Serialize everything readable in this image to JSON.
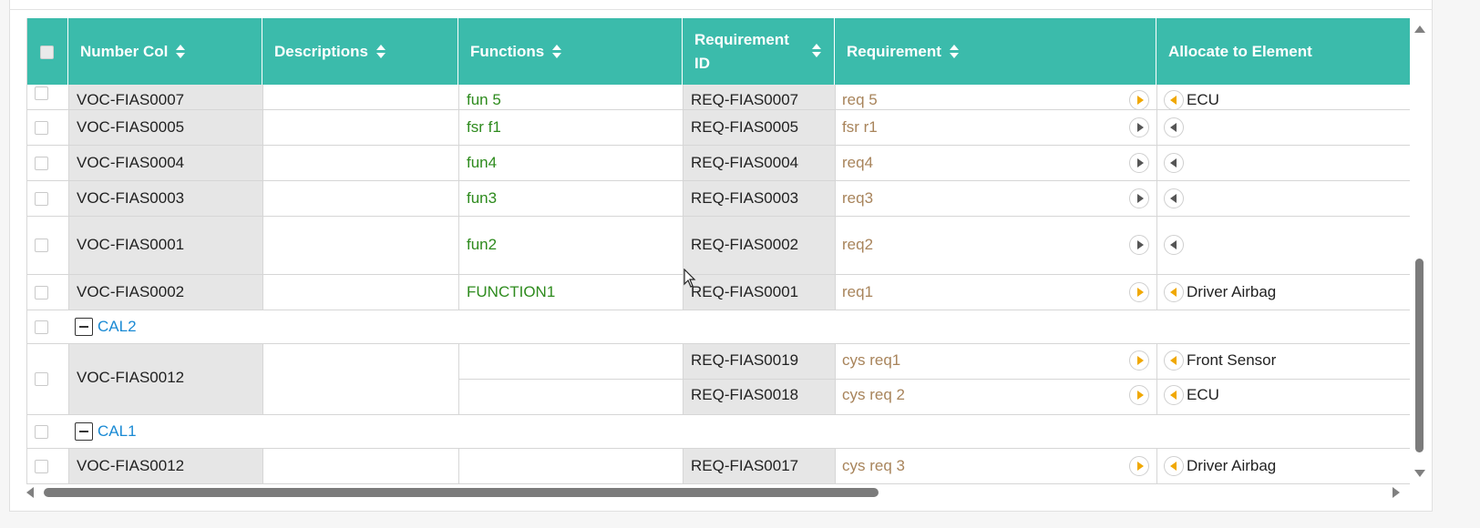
{
  "columns": {
    "number_col": "Number Col",
    "descriptions": "Descriptions",
    "functions": "Functions",
    "requirement_id": "Requirement ID",
    "requirement": "Requirement",
    "allocate_to_element": "Allocate to Element"
  },
  "partial_row": {
    "number": "VOC-FIAS0007",
    "function": "fun 5",
    "req_id": "REQ-FIAS0007",
    "requirement": "req 5",
    "element": "ECU"
  },
  "rows": [
    {
      "number": "VOC-FIAS0005",
      "function": "fsr f1",
      "req_id": "REQ-FIAS0005",
      "requirement": "fsr r1",
      "element": ""
    },
    {
      "number": "VOC-FIAS0004",
      "function": "fun4",
      "req_id": "REQ-FIAS0004",
      "requirement": "req4",
      "element": ""
    },
    {
      "number": "VOC-FIAS0003",
      "function": "fun3",
      "req_id": "REQ-FIAS0003",
      "requirement": "req3",
      "element": ""
    },
    {
      "number": "VOC-FIAS0001",
      "function": "fun2",
      "req_id": "REQ-FIAS0002",
      "requirement": "req2",
      "element": ""
    },
    {
      "number": "VOC-FIAS0002",
      "function": "FUNCTION1",
      "req_id": "REQ-FIAS0001",
      "requirement": "req1",
      "element": "Driver Airbag"
    }
  ],
  "groups": [
    {
      "label": "CAL2",
      "number": "VOC-FIAS0012",
      "subrows": [
        {
          "req_id": "REQ-FIAS0019",
          "requirement": "cys req1",
          "element": "Front Sensor"
        },
        {
          "req_id": "REQ-FIAS0018",
          "requirement": "cys req 2",
          "element": "ECU"
        }
      ]
    },
    {
      "label": "CAL1",
      "number": "VOC-FIAS0012",
      "subrows": [
        {
          "req_id": "REQ-FIAS0017",
          "requirement": "cys req 3",
          "element": "Driver Airbag"
        }
      ]
    }
  ],
  "colors": {
    "header": "#3bbbab",
    "function_text": "#2e8b1e",
    "requirement_text": "#a8845b",
    "group_link": "#1a8ad4",
    "active_arrow": "#f0a800"
  }
}
